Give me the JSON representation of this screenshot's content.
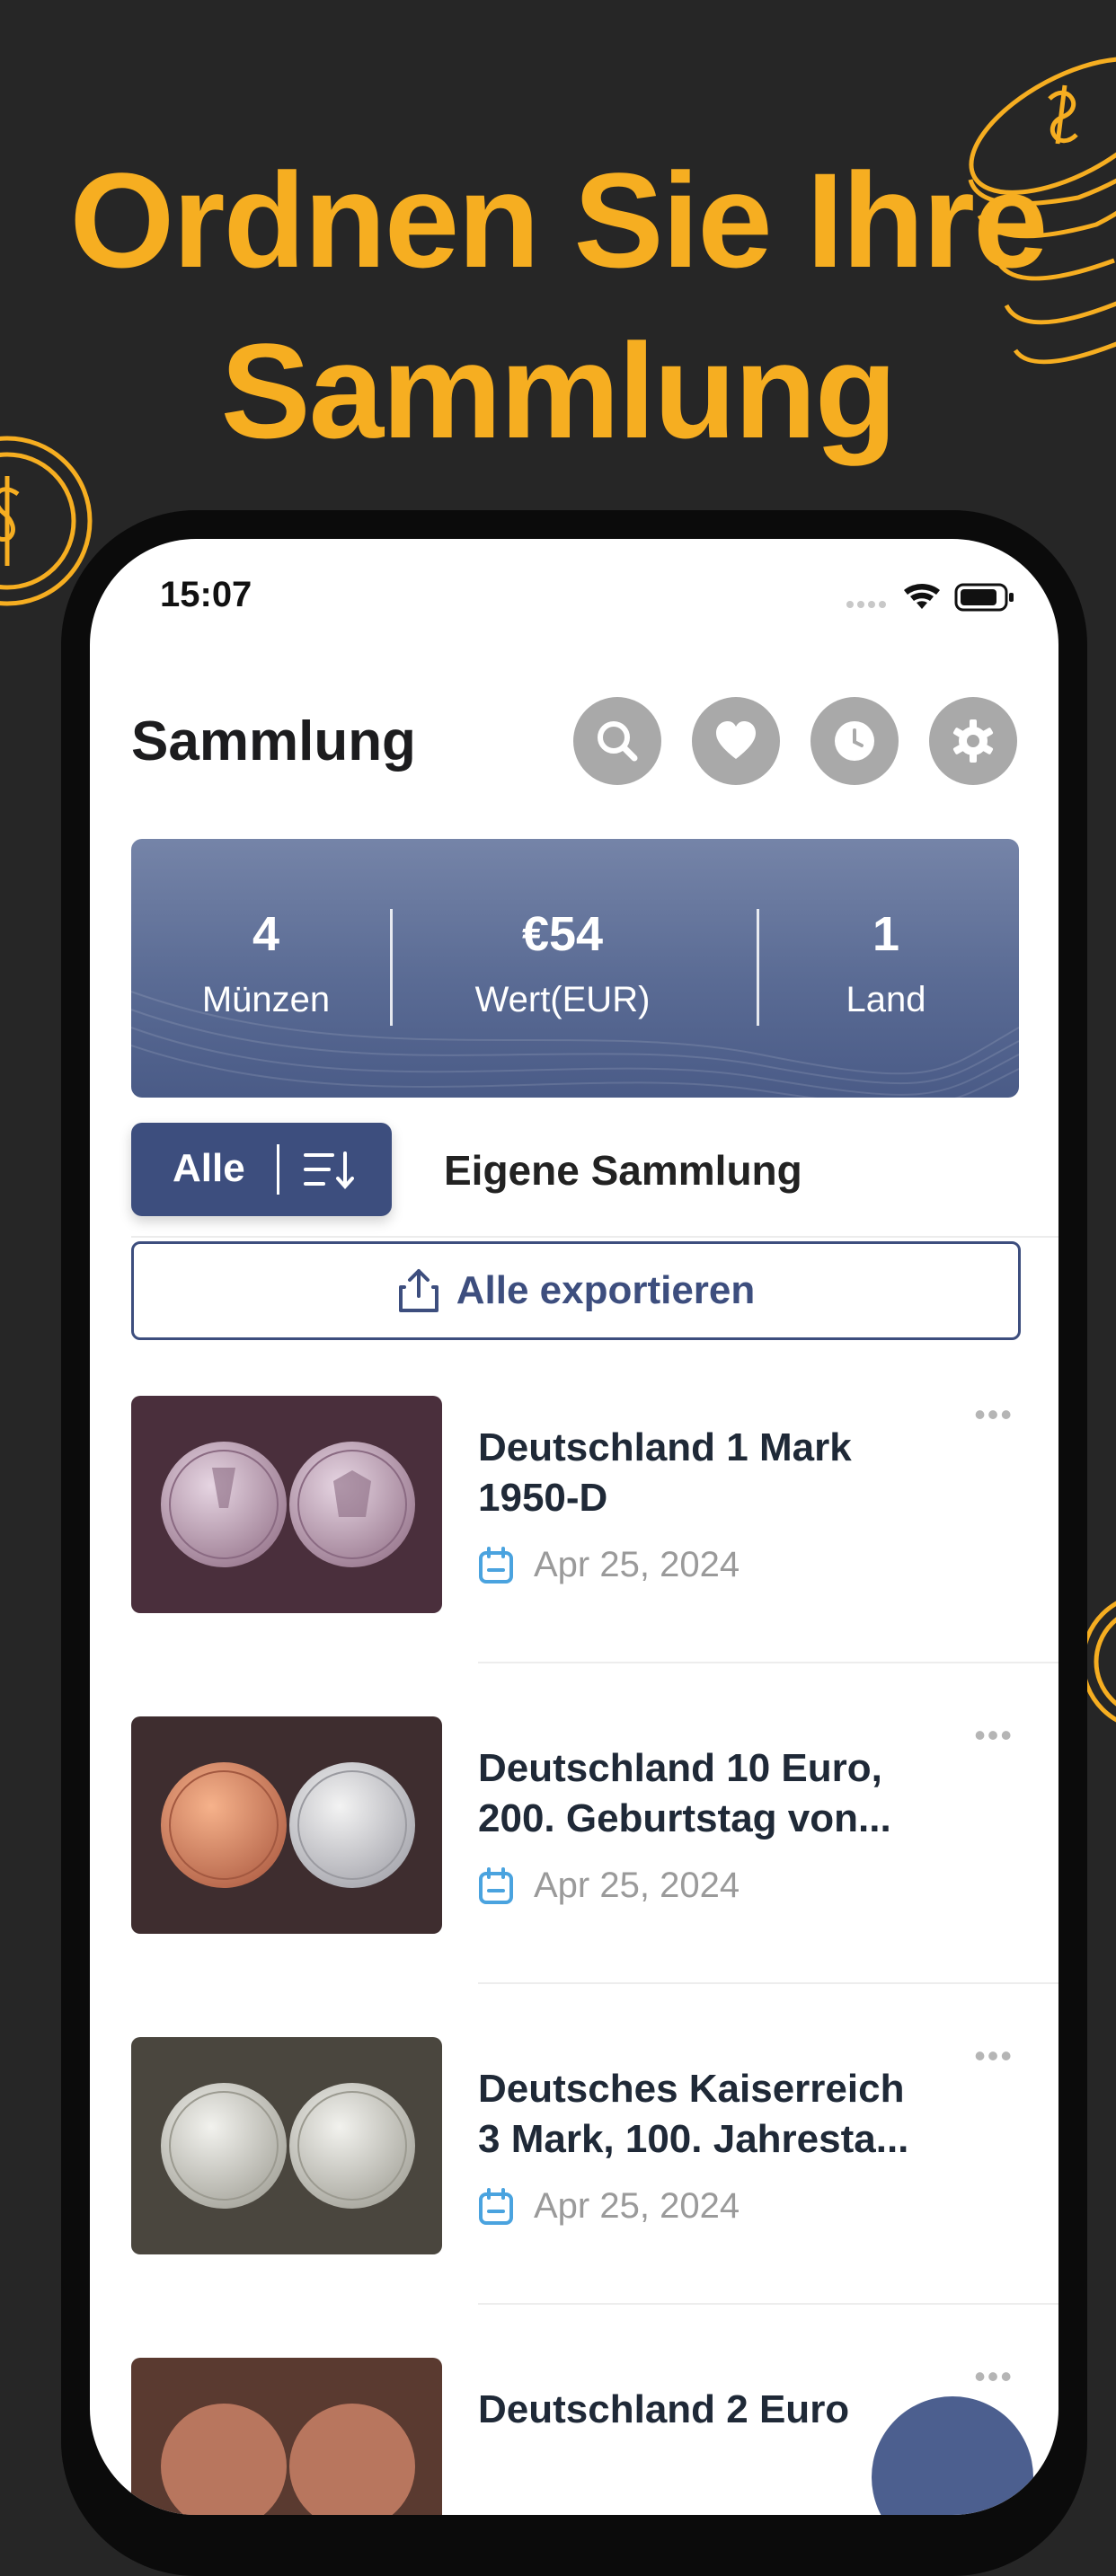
{
  "headline": {
    "line1": "Ordnen Sie Ihre",
    "line2": "Sammlung"
  },
  "status_bar": {
    "time": "15:07"
  },
  "header": {
    "title": "Sammlung",
    "icons": [
      "search-icon",
      "heart-icon",
      "clock-icon",
      "gear-icon"
    ]
  },
  "stats": [
    {
      "value": "4",
      "label": "Münzen"
    },
    {
      "value": "€54",
      "label": "Wert(EUR)"
    },
    {
      "value": "1",
      "label": "Land"
    }
  ],
  "tabs": {
    "active": "Alle",
    "other": "Eigene Sammlung"
  },
  "export_label": "Alle exportieren",
  "items": [
    {
      "title_line1": "Deutschland 1 Mark",
      "title_line2": "1950-D",
      "date": "Apr 25, 2024",
      "more": "•••"
    },
    {
      "title_line1": "Deutschland 10 Euro,",
      "title_line2": "200. Geburtstag von...",
      "date": "Apr 25, 2024",
      "more": "•••"
    },
    {
      "title_line1": "Deutsches Kaiserreich",
      "title_line2": "3 Mark, 100. Jahresta...",
      "date": "Apr 25, 2024",
      "more": "•••"
    },
    {
      "title_line1": "Deutschland 2 Euro",
      "more": "•••"
    }
  ],
  "colors": {
    "accent": "#F6AE21",
    "primary": "#3d4e7e",
    "background": "#262626"
  }
}
